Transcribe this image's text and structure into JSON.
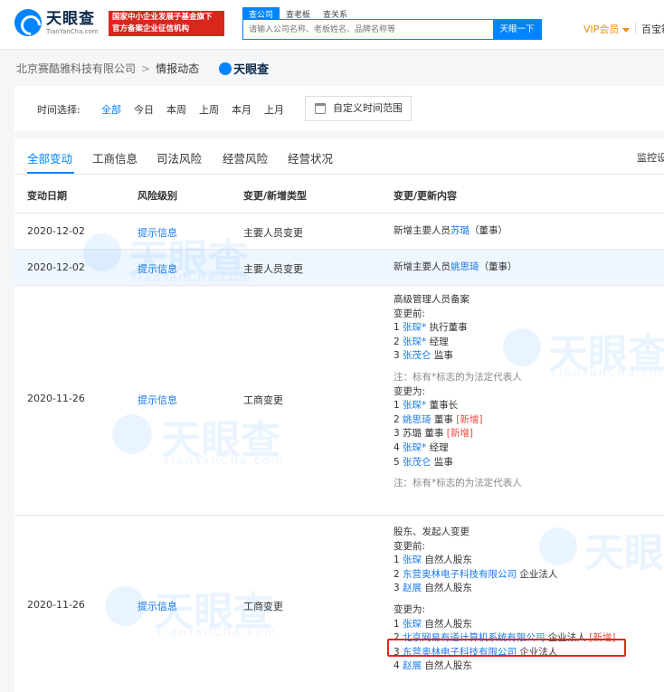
{
  "header": {
    "logo_cn": "天眼查",
    "logo_en": "TianYanCha.com",
    "banner_line1": "国家中小企业发展子基金旗下",
    "banner_line2": "官方备案企业征信机构",
    "search_tabs": [
      "查公司",
      "查老板",
      "查关系"
    ],
    "search_placeholder": "请输入公司名称、老板姓名、品牌名称等",
    "search_button": "天眼一下",
    "vip": "VIP会员",
    "baibao": "百宝箱"
  },
  "breadcrumb": {
    "company": "北京赛酷雅科技有限公司",
    "separator": ">",
    "current": "情报动态",
    "logo": "天眼查"
  },
  "time_filter": {
    "label": "时间选择:",
    "options": [
      "全部",
      "今日",
      "本周",
      "上周",
      "本月",
      "上月"
    ],
    "custom_label": "自定义时间范围"
  },
  "tabs": {
    "items": [
      "全部变动",
      "工商信息",
      "司法风险",
      "经营风险",
      "经营状况"
    ],
    "right": "监控设置"
  },
  "table": {
    "headers": [
      "变动日期",
      "风险级别",
      "变更/新增类型",
      "变更/更新内容"
    ],
    "rows": [
      {
        "date": "2020-12-02",
        "risk": "提示信息",
        "type": "主要人员变更",
        "content": {
          "pre": "新增主要人员",
          "name": "苏璐",
          "post": "（董事）"
        }
      },
      {
        "date": "2020-12-02",
        "risk": "提示信息",
        "type": "主要人员变更",
        "content": {
          "pre": "新增主要人员",
          "name": "姚思琦",
          "post": "（董事）"
        }
      },
      {
        "date": "2020-11-26",
        "risk": "提示信息",
        "type": "工商变更",
        "content": {
          "title": "高级管理人员备案",
          "before_label": "变更前:",
          "before": [
            {
              "idx": "1",
              "name": "张琛*",
              "role": "执行董事"
            },
            {
              "idx": "2",
              "name": "张琛*",
              "role": "经理"
            },
            {
              "idx": "3",
              "name": "张茂仑",
              "role": "监事"
            }
          ],
          "note": "注：标有*标志的为法定代表人",
          "after_label": "变更为:",
          "after": [
            {
              "idx": "1",
              "name": "张琛*",
              "role": "董事长",
              "tag": ""
            },
            {
              "idx": "2",
              "name": "姚思琦",
              "role": "董事",
              "tag": "[新增]"
            },
            {
              "idx": "3",
              "name": "苏璐",
              "role": "董事",
              "tag": "[新增]"
            },
            {
              "idx": "4",
              "name": "张琛*",
              "role": "经理",
              "tag": ""
            },
            {
              "idx": "5",
              "name": "张茂仑",
              "role": "监事",
              "tag": ""
            }
          ]
        }
      },
      {
        "date": "2020-11-26",
        "risk": "提示信息",
        "type": "工商变更",
        "content": {
          "title": "股东、发起人变更",
          "before_label": "变更前:",
          "before": [
            {
              "idx": "1",
              "name": "张琛",
              "role": "自然人股东"
            },
            {
              "idx": "2",
              "name": "东营奥林电子科技有限公司",
              "role": "企业法人"
            },
            {
              "idx": "3",
              "name": "赵展",
              "role": "自然人股东"
            }
          ],
          "after_label": "变更为:",
          "after": [
            {
              "idx": "1",
              "name": "张琛",
              "role": "自然人股东",
              "tag": ""
            },
            {
              "idx": "2",
              "name": "北京网易有道计算机系统有限公司",
              "role": "企业法人",
              "tag": "[新增]"
            },
            {
              "idx": "3",
              "name": "东营奥林电子科技有限公司",
              "role": "企业法人",
              "tag": ""
            },
            {
              "idx": "4",
              "name": "赵展",
              "role": "自然人股东",
              "tag": ""
            }
          ]
        }
      }
    ]
  },
  "watermark": {
    "cn": "天眼查",
    "en": "TianYanCha.com"
  },
  "colors": {
    "brand": "#0084ff",
    "link": "#1a7ae8",
    "new_tag": "#e94a3a",
    "highlight_box": "#e8231b",
    "vip": "#f08d1a"
  }
}
